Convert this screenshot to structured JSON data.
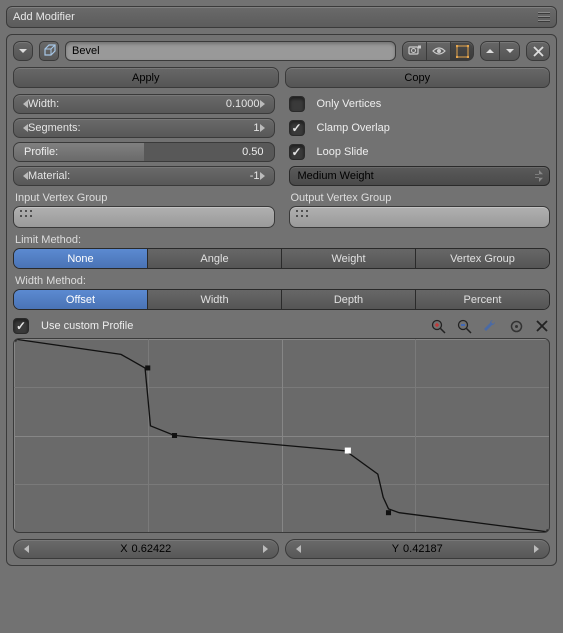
{
  "header": {
    "title": "Add Modifier"
  },
  "modifier": {
    "name": "Bevel",
    "apply": "Apply",
    "copy": "Copy"
  },
  "props": {
    "width": {
      "label": "Width:",
      "value": "0.1000"
    },
    "segments": {
      "label": "Segments:",
      "value": "1"
    },
    "profile": {
      "label": "Profile:",
      "value": "0.50",
      "fill_pct": 50
    },
    "material": {
      "label": "Material:",
      "value": "-1"
    }
  },
  "checks": {
    "only_vertices": {
      "label": "Only Vertices",
      "checked": false
    },
    "clamp_overlap": {
      "label": "Clamp Overlap",
      "checked": true
    },
    "loop_slide": {
      "label": "Loop Slide",
      "checked": true
    }
  },
  "weight_mode": {
    "selected": "Medium Weight"
  },
  "vgroups": {
    "input_label": "Input Vertex Group",
    "output_label": "Output Vertex Group"
  },
  "limit": {
    "label": "Limit Method:",
    "options": [
      "None",
      "Angle",
      "Weight",
      "Vertex Group"
    ],
    "active": 0
  },
  "widthm": {
    "label": "Width Method:",
    "options": [
      "Offset",
      "Width",
      "Depth",
      "Percent"
    ],
    "active": 0
  },
  "custom_profile": {
    "label": "Use custom Profile",
    "checked": true,
    "x": {
      "label": "X",
      "value": "0.62422"
    },
    "y": {
      "label": "Y",
      "value": "0.42187"
    }
  },
  "chart_data": {
    "type": "line",
    "title": "",
    "xlabel": "",
    "ylabel": "",
    "xlim": [
      0,
      1
    ],
    "ylim": [
      0,
      1
    ],
    "x": [
      0.0,
      0.2,
      0.245,
      0.25,
      0.255,
      0.3,
      0.62,
      0.68,
      0.69,
      0.7,
      0.72,
      1.0
    ],
    "y": [
      1.0,
      0.92,
      0.85,
      0.7,
      0.55,
      0.5,
      0.42,
      0.3,
      0.18,
      0.12,
      0.1,
      0.0
    ],
    "handles": [
      {
        "x": 0.0,
        "y": 1.0
      },
      {
        "x": 0.25,
        "y": 0.85
      },
      {
        "x": 0.3,
        "y": 0.5
      },
      {
        "x": 0.624,
        "y": 0.422
      },
      {
        "x": 0.7,
        "y": 0.1
      },
      {
        "x": 1.0,
        "y": 0.0
      }
    ]
  }
}
